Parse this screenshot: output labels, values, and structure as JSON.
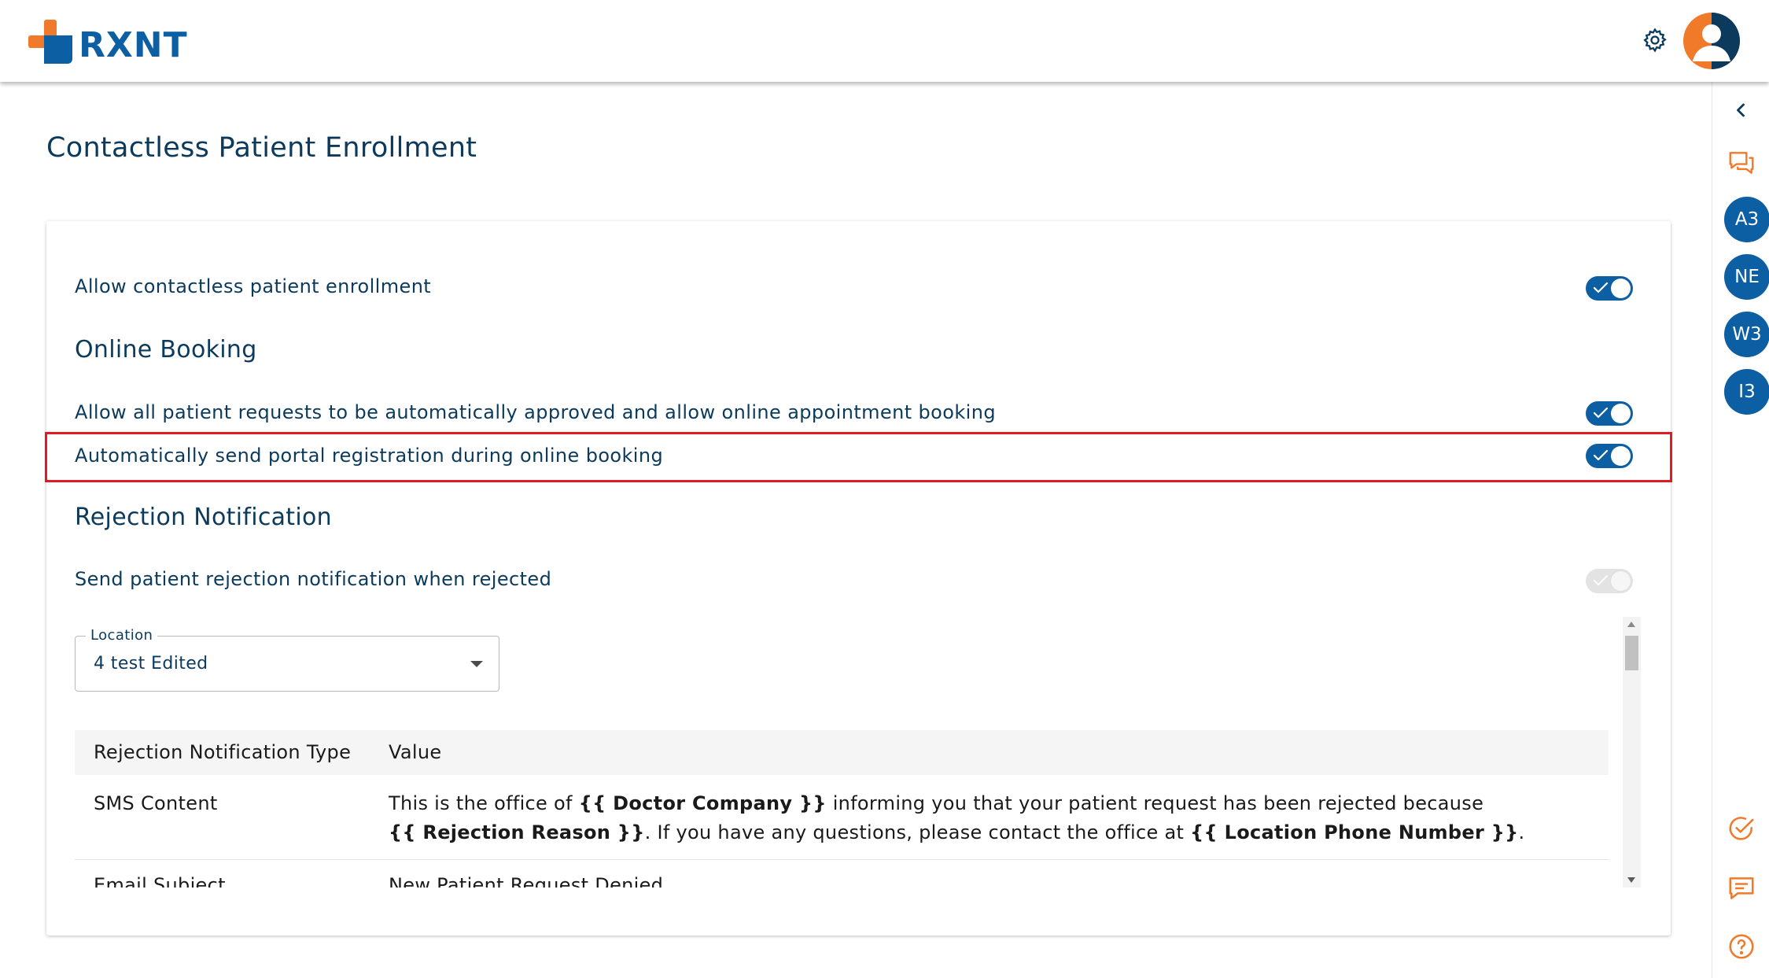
{
  "header": {
    "logo_text": "RXNT",
    "settings_icon": "gear-icon",
    "avatar_icon": "user-avatar-icon"
  },
  "rail": {
    "collapse_icon": "chevron-left-icon",
    "chat_icon": "chat-bubbles-icon",
    "badges": [
      "A3",
      "NE",
      "W3",
      "I3"
    ],
    "task_icon": "check-circle-icon",
    "message_icon": "message-icon",
    "help_icon": "help-circle-icon"
  },
  "page": {
    "title": "Contactless Patient Enrollment"
  },
  "settings": {
    "allow_enrollment": {
      "label": "Allow contactless patient enrollment",
      "on": true
    },
    "online_booking_heading": "Online Booking",
    "auto_approve": {
      "label": "Allow all patient requests to be automatically approved and allow online appointment booking",
      "on": true
    },
    "auto_portal": {
      "label": "Automatically send portal registration during online booking",
      "on": true
    },
    "rejection_heading": "Rejection Notification",
    "send_rejection": {
      "label": "Send patient rejection notification when rejected",
      "on": true,
      "disabled": true
    }
  },
  "location": {
    "legend": "Location",
    "value": "4 test Edited"
  },
  "table": {
    "headers": [
      "Rejection Notification Type",
      "Value"
    ],
    "rows": [
      {
        "type": "SMS Content",
        "value_parts": {
          "p1": "This is the office of ",
          "b1": "{{ Doctor Company }}",
          "p2": " informing you that your patient request has been rejected because",
          "b2": "{{ Rejection Reason }}",
          "p3": ". If you have any questions, please contact the office at ",
          "b3": "{{ Location Phone Number }}",
          "p4": "."
        }
      },
      {
        "type": "Email Subject",
        "value": "New Patient Request Denied"
      }
    ]
  },
  "colors": {
    "brand_blue": "#0d5fa3",
    "brand_orange": "#f07a2a",
    "highlight_red": "#e01b24",
    "text_navy": "#0b3a5c"
  }
}
